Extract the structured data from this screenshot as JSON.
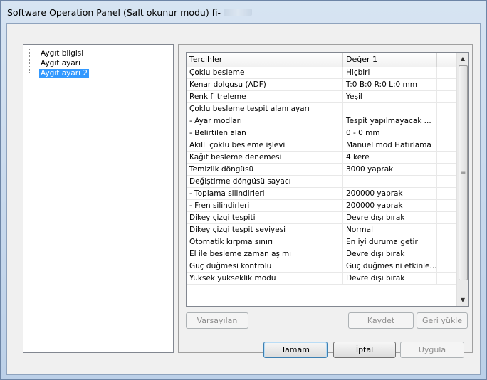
{
  "window": {
    "title": "Software Operation Panel (Salt okunur modu) fi-"
  },
  "tree": {
    "items": [
      {
        "label": "Aygıt bilgisi",
        "selected": false
      },
      {
        "label": "Aygıt ayarı",
        "selected": false
      },
      {
        "label": "Aygıt ayarı 2",
        "selected": true
      }
    ]
  },
  "grid": {
    "headers": [
      "Tercihler",
      "Değer 1",
      ""
    ],
    "rows": [
      [
        "Çoklu besleme",
        "Hiçbiri"
      ],
      [
        "Kenar dolgusu (ADF)",
        "T:0 B:0 R:0 L:0 mm"
      ],
      [
        "Renk filtreleme",
        "Yeşil"
      ],
      [
        "Çoklu besleme tespit alanı ayarı",
        ""
      ],
      [
        " - Ayar modları",
        "Tespit yapılmayacak ..."
      ],
      [
        " - Belirtilen alan",
        "0 - 0 mm"
      ],
      [
        "Akıllı çoklu besleme işlevi",
        "Manuel mod  Hatırlama"
      ],
      [
        "Kağıt besleme denemesi",
        "4 kere"
      ],
      [
        "Temizlik döngüsü",
        "3000 yaprak"
      ],
      [
        "Değiştirme döngüsü sayacı",
        ""
      ],
      [
        " - Toplama silindirleri",
        "200000 yaprak"
      ],
      [
        " - Fren silindirleri",
        "200000 yaprak"
      ],
      [
        "Dikey çizgi tespiti",
        "Devre dışı bırak"
      ],
      [
        "Dikey çizgi tespit seviyesi",
        "Normal"
      ],
      [
        "Otomatik kırpma sınırı",
        "En iyi duruma getir"
      ],
      [
        "El ile besleme zaman aşımı",
        "Devre dışı bırak"
      ],
      [
        "Güç düğmesi kontrolü",
        "Güç düğmesini etkinle..."
      ],
      [
        "Yüksek yükseklik modu",
        "Devre dışı bırak"
      ]
    ]
  },
  "scrollbar": {
    "up_icon": "▲",
    "down_icon": "▼",
    "grip_icon": "≡"
  },
  "buttons": {
    "defaults": "Varsayılan",
    "save": "Kaydet",
    "restore": "Geri yükle",
    "ok": "Tamam",
    "cancel": "İptal",
    "apply": "Uygula"
  }
}
